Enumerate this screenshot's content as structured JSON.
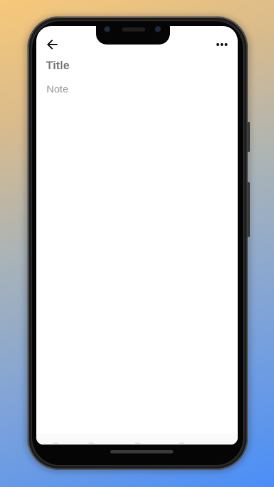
{
  "editor": {
    "title_placeholder": "Title",
    "note_placeholder": "Note"
  },
  "toolbar": {
    "back_icon": "arrow-back-icon",
    "more_icon": "more-horizontal-icon"
  },
  "colors": {
    "background_top": "#f7c87a",
    "background_bottom": "#4a8ef8",
    "screen": "#ffffff",
    "placeholder": "#8a8a8a"
  }
}
